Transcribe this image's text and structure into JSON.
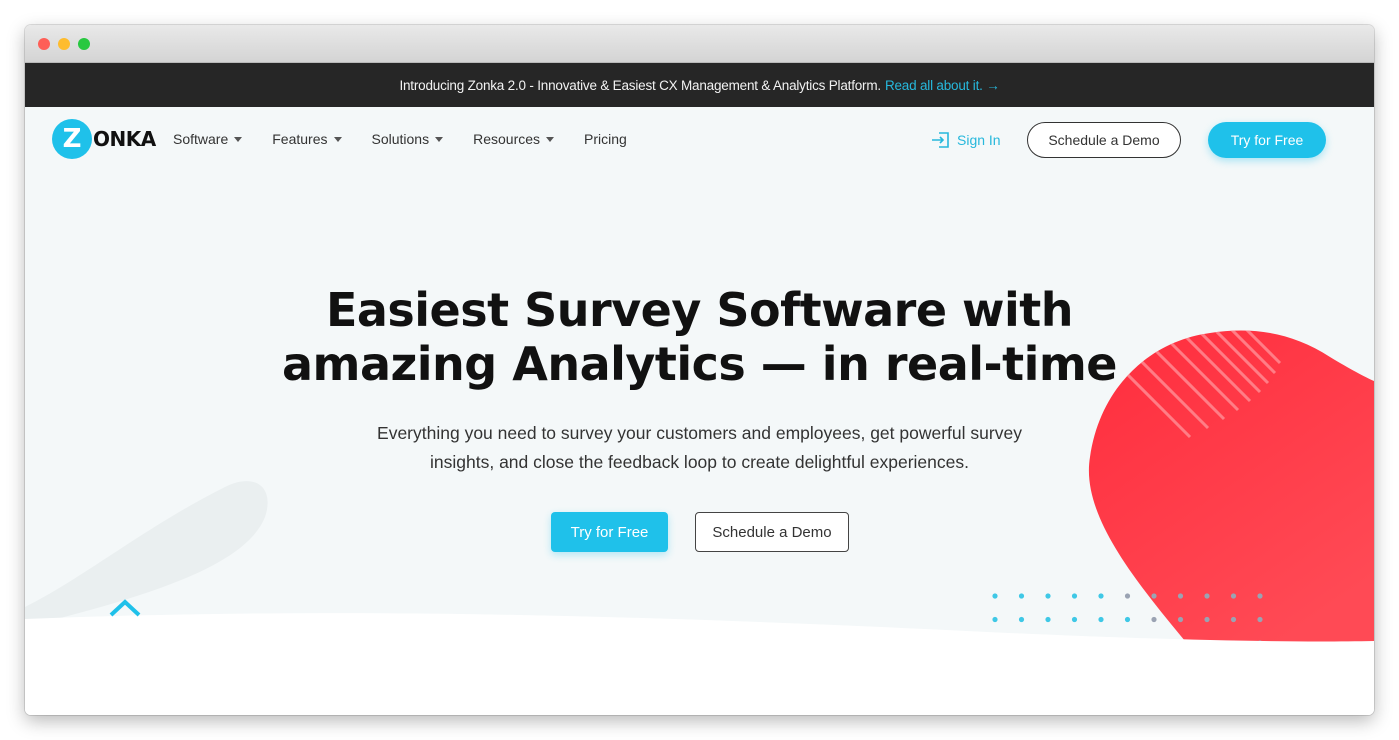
{
  "window": {
    "controls": [
      "close",
      "minimize",
      "maximize"
    ]
  },
  "announcement": {
    "text": "Introducing Zonka 2.0 - Innovative & Easiest CX Management & Analytics Platform.",
    "link": "Read all about it. →"
  },
  "logo": {
    "mark": "Z",
    "text": "ONKA"
  },
  "nav": {
    "items": [
      {
        "label": "Software",
        "dropdown": true
      },
      {
        "label": "Features",
        "dropdown": true
      },
      {
        "label": "Solutions",
        "dropdown": true
      },
      {
        "label": "Resources",
        "dropdown": true
      },
      {
        "label": "Pricing",
        "dropdown": false
      }
    ],
    "sign_in": "Sign In",
    "schedule_demo": "Schedule a Demo",
    "try_free": "Try for Free"
  },
  "hero": {
    "headline_line1": "Easiest Survey Software with",
    "headline_line2": "amazing Analytics — in real-time",
    "subtext_line1": "Everything you need to survey your customers and employees, get powerful survey",
    "subtext_line2": "insights, and close the feedback loop to create delightful experiences.",
    "cta_primary": "Try for Free",
    "cta_secondary": "Schedule a Demo"
  },
  "colors": {
    "accent": "#1fc1ea",
    "announce_bg": "#262626",
    "announce_link": "#27b8dc",
    "hero_bg": "#f4f8f9",
    "blob_red": "#ff3b47"
  }
}
